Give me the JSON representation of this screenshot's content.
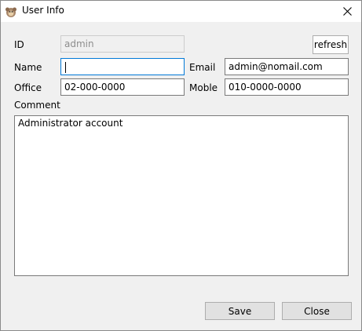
{
  "window": {
    "title": "User Info",
    "close_label": "Close window"
  },
  "labels": {
    "id": "ID",
    "name": "Name",
    "email": "Email",
    "office": "Office",
    "mobile": "Moble",
    "comment": "Comment"
  },
  "fields": {
    "id_value": "admin",
    "name_value": "",
    "email_value": "admin@nomail.com",
    "office_value": "02-000-0000",
    "mobile_value": "010-0000-0000",
    "comment_value": "Administrator account"
  },
  "buttons": {
    "refresh": "refresh",
    "save": "Save",
    "close": "Close"
  },
  "colors": {
    "focus_border": "#0078d7",
    "dialog_bg": "#f0f0f0"
  }
}
